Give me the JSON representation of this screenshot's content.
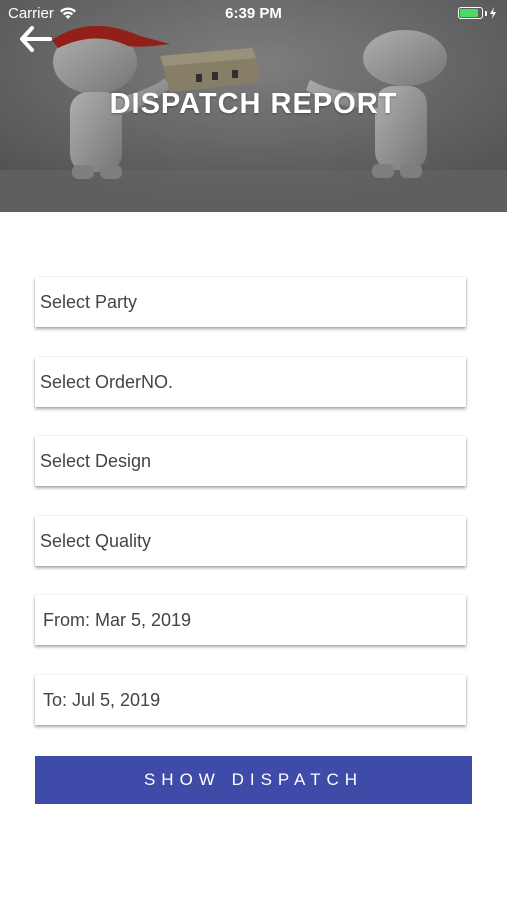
{
  "status_bar": {
    "carrier": "Carrier",
    "time": "6:39 PM",
    "battery_level": 0.85
  },
  "header": {
    "title": "DISPATCH REPORT",
    "back_icon": "arrow-left-icon",
    "image": "delivery-illustration"
  },
  "form": {
    "party_placeholder": "Select Party",
    "order_placeholder": "Select OrderNO.",
    "design_placeholder": "Select Design",
    "quality_placeholder": "Select Quality",
    "from_date": "From: Mar 5, 2019",
    "to_date": "To: Jul 5, 2019"
  },
  "actions": {
    "show_label": "SHOW DISPATCH",
    "button_color": "#3e4ba9"
  }
}
